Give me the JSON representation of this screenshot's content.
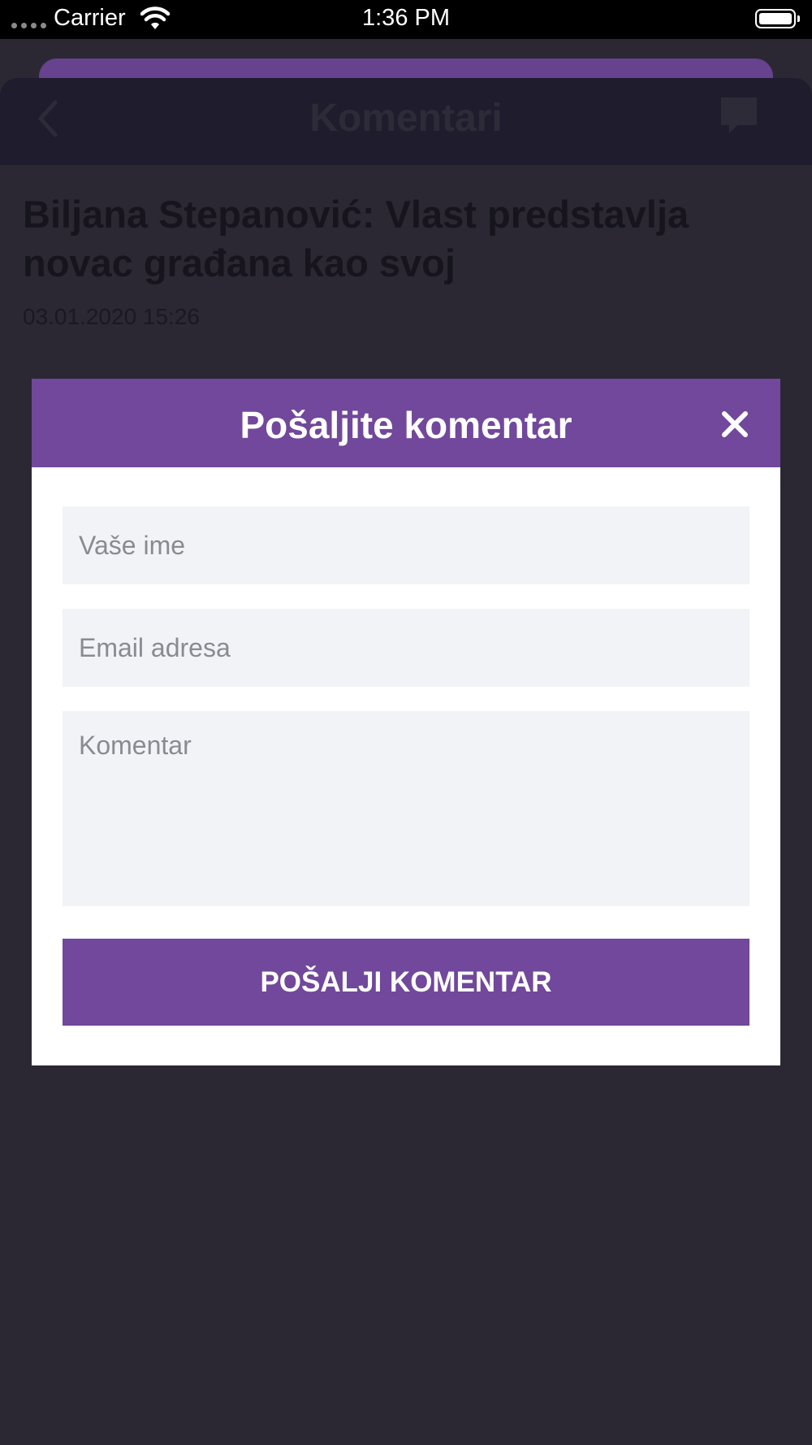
{
  "status_bar": {
    "carrier": "Carrier",
    "time": "1:36 PM"
  },
  "nav": {
    "title": "Komentari"
  },
  "article": {
    "title": "Biljana Stepanović: Vlast predstavlja novac građana kao svoj",
    "date": "03.01.2020 15:26"
  },
  "modal": {
    "title": "Pošaljite komentar",
    "name_placeholder": "Vaše ime",
    "email_placeholder": "Email adresa",
    "comment_placeholder": "Komentar",
    "submit_label": "POŠALJI KOMENTAR"
  },
  "colors": {
    "accent": "#71489b",
    "nav_background": "#1f1c2d",
    "overlay_background": "#2b2833",
    "field_background": "#f2f3f7"
  },
  "icons": {
    "back": "chevron-left-icon",
    "comment": "comment-bubble-icon",
    "close": "close-icon",
    "wifi": "wifi-icon",
    "battery": "battery-icon"
  }
}
